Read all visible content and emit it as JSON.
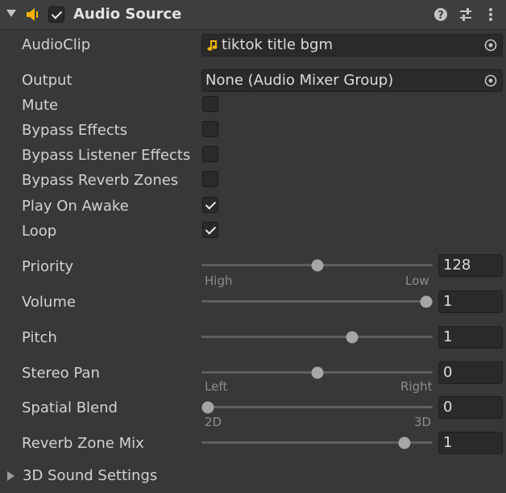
{
  "header": {
    "title": "Audio Source",
    "enabled": true,
    "icons": [
      "fold-arrow-icon",
      "speaker-icon",
      "help-icon",
      "presets-icon",
      "more-icon"
    ]
  },
  "audioclip": {
    "label": "AudioClip",
    "value": "tiktok title bgm",
    "icon": "music-note-icon"
  },
  "output": {
    "label": "Output",
    "value": "None (Audio Mixer Group)"
  },
  "toggles": [
    {
      "label": "Mute",
      "checked": false
    },
    {
      "label": "Bypass Effects",
      "checked": false
    },
    {
      "label": "Bypass Listener Effects",
      "checked": false
    },
    {
      "label": "Bypass Reverb Zones",
      "checked": false
    },
    {
      "label": "Play On Awake",
      "checked": true
    },
    {
      "label": "Loop",
      "checked": true
    }
  ],
  "sliders": [
    {
      "label": "Priority",
      "value": "128",
      "fraction": 0.5,
      "left": "High",
      "right": "Low"
    },
    {
      "label": "Volume",
      "value": "1",
      "fraction": 1.0
    },
    {
      "label": "Pitch",
      "value": "1",
      "fraction": 0.66
    },
    {
      "label": "Stereo Pan",
      "value": "0",
      "fraction": 0.5,
      "left": "Left",
      "right": "Right"
    },
    {
      "label": "Spatial Blend",
      "value": "0",
      "fraction": 0.0,
      "left": "2D",
      "right": "3D"
    },
    {
      "label": "Reverb Zone Mix",
      "value": "1",
      "fraction": 0.9
    }
  ],
  "foldout": {
    "label": "3D Sound Settings"
  },
  "colors": {
    "accent": "#f4b400",
    "background": "#383838"
  }
}
